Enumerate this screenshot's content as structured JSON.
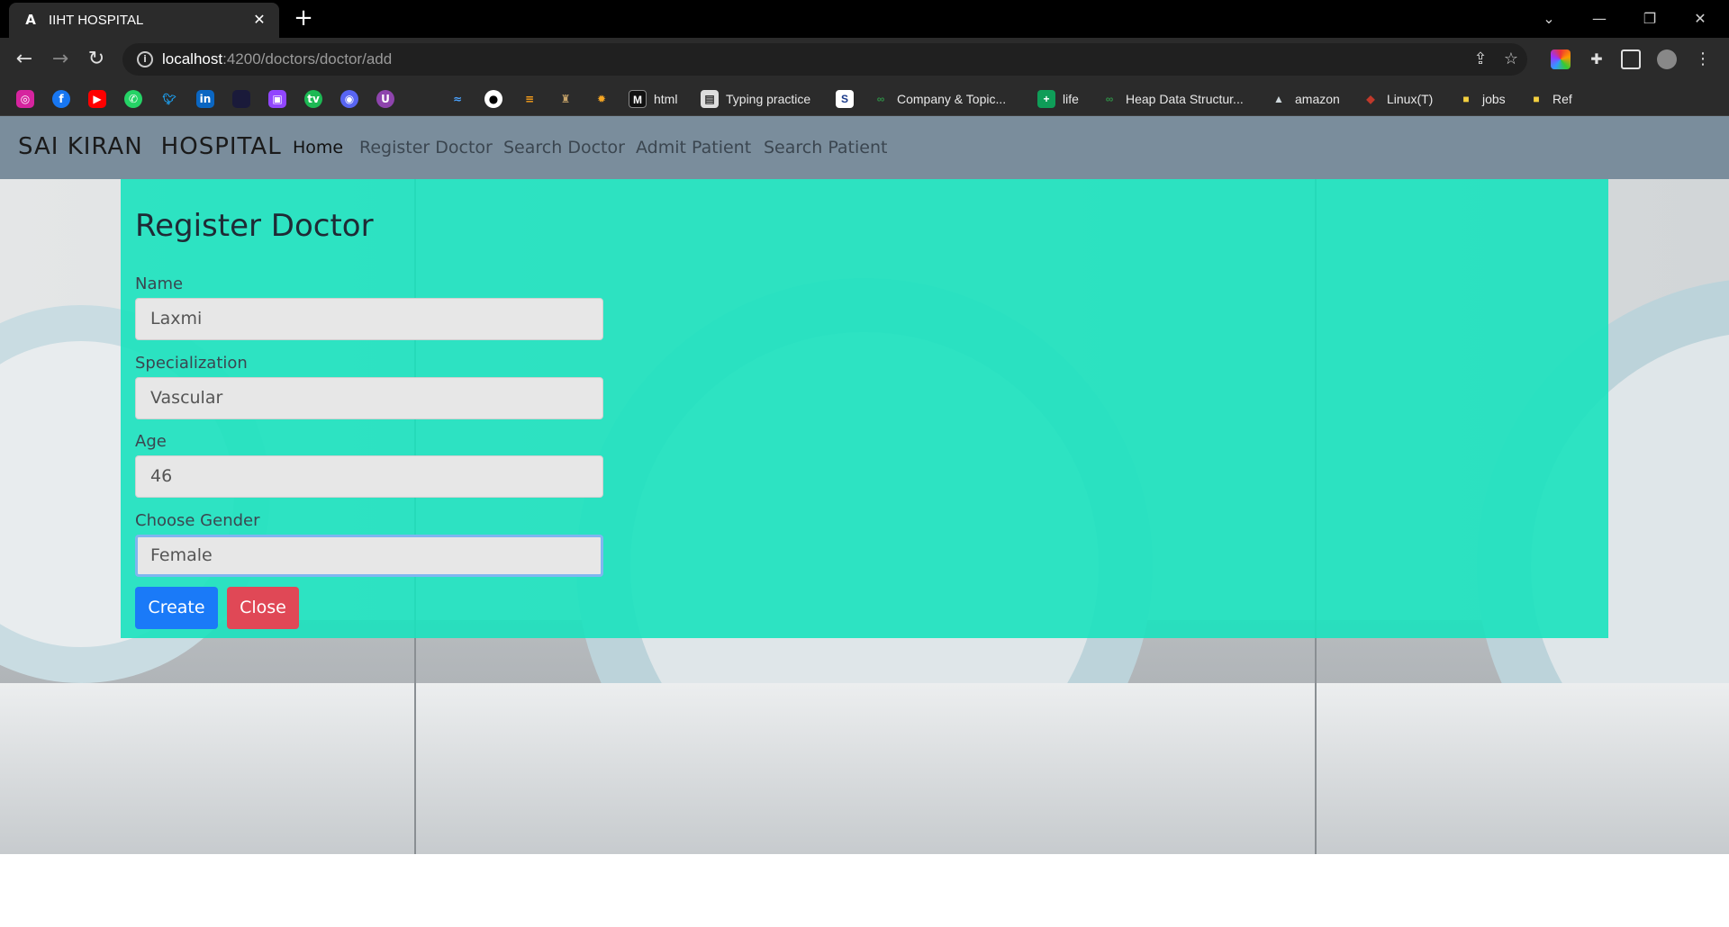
{
  "browser": {
    "tab_title": "IIHT HOSPITAL",
    "tab_favicon": "A",
    "url_host": "localhost",
    "url_path": ":4200/doctors/doctor/add",
    "bookmarks": [
      {
        "label": "html",
        "icon": "m-icon"
      },
      {
        "label": "Typing practice",
        "icon": "page-icon"
      },
      {
        "label": "Company & Topic...",
        "icon": "gfg-icon"
      },
      {
        "label": "life",
        "icon": "plus-icon"
      },
      {
        "label": "Heap Data Structur...",
        "icon": "gfg-icon"
      },
      {
        "label": "amazon",
        "icon": "mountain-icon"
      },
      {
        "label": "Linux(T)",
        "icon": "box-icon"
      },
      {
        "label": "jobs",
        "icon": "folder-icon"
      },
      {
        "label": "Ref",
        "icon": "folder-icon"
      }
    ]
  },
  "app": {
    "brand_part1": "SAI KIRAN",
    "brand_part2": "HOSPITAL",
    "nav": [
      {
        "label": "Home"
      },
      {
        "label": "Register Doctor"
      },
      {
        "label": "Search Doctor"
      },
      {
        "label": "Admit Patient"
      },
      {
        "label": "Search Patient"
      }
    ]
  },
  "form": {
    "title": "Register Doctor",
    "name_label": "Name",
    "name_value": "Laxmi",
    "specialization_label": "Specialization",
    "specialization_value": "Vascular",
    "age_label": "Age",
    "age_value": "46",
    "gender_label": "Choose Gender",
    "gender_value": "Female",
    "create_label": "Create",
    "close_label": "Close"
  },
  "colors": {
    "panel": "#1ae2be",
    "navbar": "#7a8d9c",
    "create": "#1a7af8",
    "close": "#e04856"
  }
}
